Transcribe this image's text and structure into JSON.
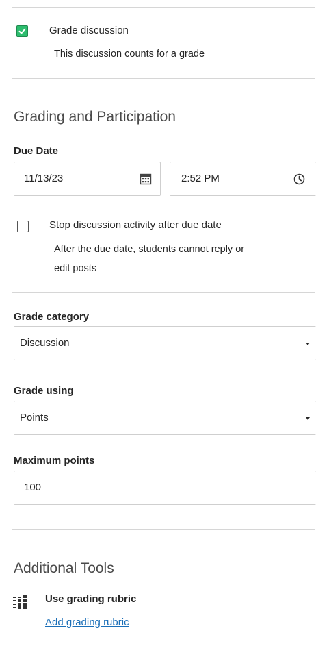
{
  "grade_discussion": {
    "checked": true,
    "label": "Grade discussion",
    "description": "This discussion counts for a grade"
  },
  "grading": {
    "title": "Grading and Participation",
    "due_date": {
      "label": "Due Date",
      "date_value": "11/13/23",
      "time_value": "2:52 PM"
    },
    "stop_activity": {
      "checked": false,
      "label": "Stop discussion activity after due date",
      "description_line1": "After the due date, students cannot reply or",
      "description_line2": "edit posts"
    },
    "grade_category": {
      "label": "Grade category",
      "value": "Discussion"
    },
    "grade_using": {
      "label": "Grade using",
      "value": "Points"
    },
    "maximum_points": {
      "label": "Maximum points",
      "value": "100"
    }
  },
  "additional_tools": {
    "title": "Additional Tools",
    "rubric_label": "Use grading rubric",
    "rubric_link": "Add grading rubric"
  },
  "colors": {
    "checkbox_checked": "#2dbd6e",
    "link": "#1b6fb8",
    "border": "#cfcfcf"
  },
  "icons": [
    "check-icon",
    "calendar-icon",
    "clock-icon",
    "dropdown-caret-icon",
    "rubric-grid-icon"
  ]
}
